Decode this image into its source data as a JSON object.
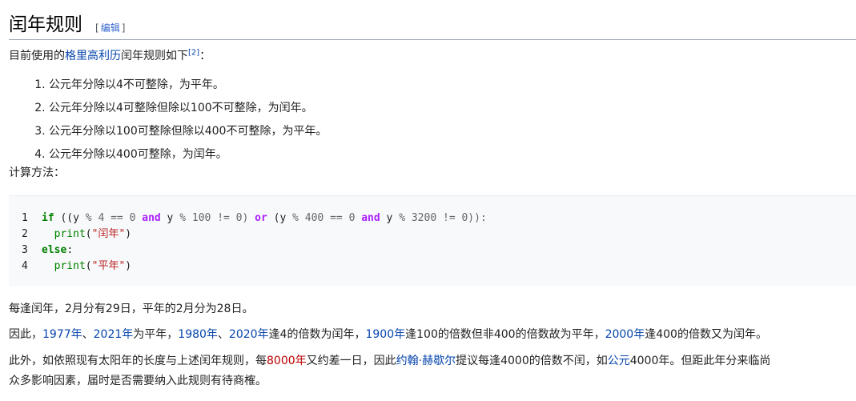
{
  "heading": {
    "title": "闰年规则",
    "edit_label": "编辑"
  },
  "intro": {
    "before": "目前使用的",
    "link": "格里高利历",
    "after": "闰年规则如下",
    "ref": "[2]",
    "end": "："
  },
  "rules": [
    "公元年分除以4不可整除，为平年。",
    "公元年分除以4可整除但除以100不可整除，为闰年。",
    "公元年分除以100可整除但除以400不可整除，为平年。",
    "公元年分除以400可整除，为闰年。"
  ],
  "calc_label": "计算方法：",
  "code": {
    "line_numbers": [
      "1",
      "2",
      "3",
      "4"
    ],
    "l1": {
      "kw_if": "if",
      "p1": " ((y ",
      "m1": "%",
      "n4": " 4 ",
      "eq1": "==",
      "n0a": " 0 ",
      "and1": "and",
      "p2": " y ",
      "m2": "%",
      "n100": " 100 ",
      "ne1": "!=",
      "n0b": " 0) ",
      "or": "or",
      "p3": " (y ",
      "m3": "%",
      "n400": " 400 ",
      "eq2": "==",
      "n0c": " 0 ",
      "and2": "and",
      "p4": " y ",
      "m4": "%",
      "n3200": " 3200 ",
      "ne2": "!=",
      "n0d": " 0)):"
    },
    "l2": {
      "indent": "  ",
      "fn": "print",
      "open": "(",
      "str": "\"闰年\"",
      "close": ")"
    },
    "l3": {
      "kw_else": "else",
      "colon": ":"
    },
    "l4": {
      "indent": "  ",
      "fn": "print",
      "open": "(",
      "str": "\"平年\"",
      "close": ")"
    }
  },
  "para1": "每逢闰年，2月分有29日，平年的2月分为28日。",
  "para2": {
    "t1": "因此，",
    "l1977": "1977年",
    "s1": "、",
    "l2021": "2021年",
    "t2": "为平年，",
    "l1980": "1980年",
    "s2": "、",
    "l2020": "2020年",
    "t3": "逢4的倍数为闰年，",
    "l1900": "1900年",
    "t4": "逢100的倍数但非400的倍数故为平年，",
    "l2000": "2000年",
    "t5": "逢400的倍数又为闰年。"
  },
  "para3": {
    "t1": "此外，如依照现有太阳年的长度与上述闰年规则，每",
    "l8000": "8000年",
    "t2": "又约差一日，因此",
    "lperson": "约翰·赫歇尔",
    "t3": "提议每逢4000的倍数不闰，如",
    "lad": "公元",
    "t4": "4000年。但距此年分来临尚",
    "line2": "众多影响因素，届时是否需要纳入此规则有待商榷。"
  }
}
